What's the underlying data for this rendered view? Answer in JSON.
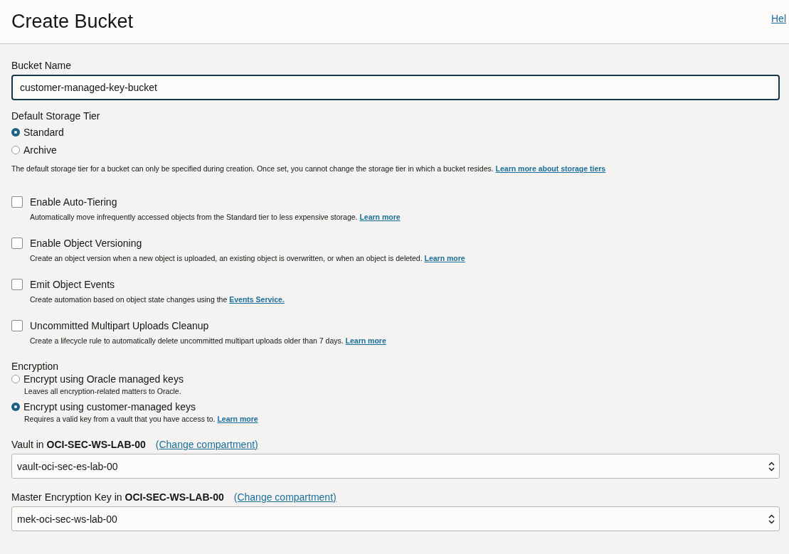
{
  "header": {
    "title": "Create Bucket",
    "help_link": "Hel"
  },
  "bucket_name": {
    "label": "Bucket Name",
    "value": "customer-managed-key-bucket"
  },
  "storage_tier": {
    "label": "Default Storage Tier",
    "options": [
      {
        "label": "Standard",
        "selected": true
      },
      {
        "label": "Archive",
        "selected": false
      }
    ],
    "help": {
      "text": "The default storage tier for a bucket can only be specified during creation. Once set, you cannot change the storage tier in which a bucket resides. ",
      "link": "Learn more about storage tiers"
    }
  },
  "options": [
    {
      "label": "Enable Auto-Tiering",
      "checked": false,
      "description": "Automatically move infrequently accessed objects from the Standard tier to less expensive storage. ",
      "link": "Learn more"
    },
    {
      "label": "Enable Object Versioning",
      "checked": false,
      "description": "Create an object version when a new object is uploaded, an existing object is overwritten, or when an object is deleted. ",
      "link": "Learn more"
    },
    {
      "label": "Emit Object Events",
      "checked": false,
      "description": "Create automation based on object state changes using the ",
      "link": "Events Service."
    },
    {
      "label": "Uncommitted Multipart Uploads Cleanup",
      "checked": false,
      "description": "Create a lifecycle rule to automatically delete uncommitted multipart uploads older than 7 days. ",
      "link": "Learn more"
    }
  ],
  "encryption": {
    "label": "Encryption",
    "options": [
      {
        "label": "Encrypt using Oracle managed keys",
        "selected": false,
        "description": "Leaves all encryption-related matters to Oracle."
      },
      {
        "label": "Encrypt using customer-managed keys",
        "selected": true,
        "description": "Requires a valid key from a vault that you have access to. ",
        "link": "Learn more"
      }
    ]
  },
  "selects": [
    {
      "label": "Vault in **OCI-SEC-WS-LAB-00**",
      "link": "(Change compartment)",
      "value": "vault-oci-sec-es-lab-00"
    },
    {
      "label": "Master Encryption Key in **OCI-SEC-WS-LAB-00**",
      "link": "(Change compartment)",
      "value": "mek-oci-sec-ws-lab-00"
    }
  ]
}
